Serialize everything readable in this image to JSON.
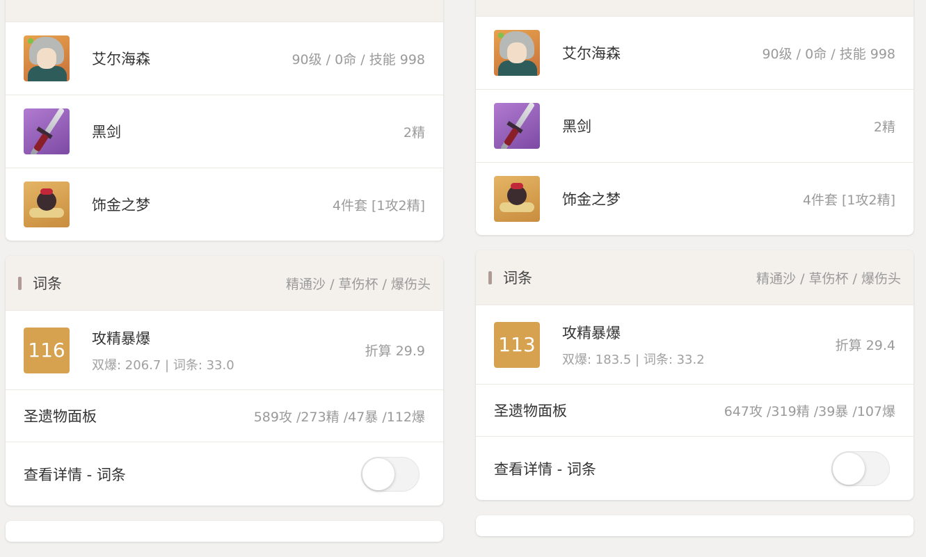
{
  "panels": [
    {
      "build": {
        "character": {
          "name": "艾尔海森",
          "detail": "90级 / 0命 / 技能 998"
        },
        "weapon": {
          "name": "黑剑",
          "detail": "2精"
        },
        "artifact": {
          "name": "饰金之梦",
          "detail": "4件套 [1攻2精]"
        }
      },
      "substats": {
        "title": "词条",
        "mainstats": "精通沙 / 草伤杯 / 爆伤头",
        "score": "116",
        "score_title": "攻精暴爆",
        "score_sub": "双爆: 206.7 | 词条: 33.0",
        "converted": "折算 29.9",
        "panel_label": "圣遗物面板",
        "panel_value": "589攻 /273精 /47暴 /112爆",
        "details_label": "查看详情 - 词条",
        "details_toggle": false
      }
    },
    {
      "build": {
        "character": {
          "name": "艾尔海森",
          "detail": "90级 / 0命 / 技能 998"
        },
        "weapon": {
          "name": "黑剑",
          "detail": "2精"
        },
        "artifact": {
          "name": "饰金之梦",
          "detail": "4件套 [1攻2精]"
        }
      },
      "substats": {
        "title": "词条",
        "mainstats": "精通沙 / 草伤杯 / 爆伤头",
        "score": "113",
        "score_title": "攻精暴爆",
        "score_sub": "双爆: 183.5 | 词条: 33.2",
        "converted": "折算 29.4",
        "panel_label": "圣遗物面板",
        "panel_value": "647攻 /319精 /39暴 /107爆",
        "details_label": "查看详情 - 词条",
        "details_toggle": false
      }
    }
  ],
  "colors": {
    "score_badge": "#d6a24f",
    "header_bg": "#f4f1ec",
    "header_bar": "#b09a96"
  },
  "icons": {
    "character": "alhaitham-avatar",
    "weapon": "black-sword-icon",
    "artifact": "gilded-dreams-icon"
  }
}
